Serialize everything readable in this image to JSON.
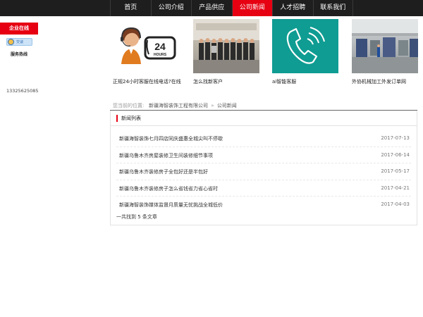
{
  "nav": {
    "items": [
      {
        "label": "首页",
        "active": false
      },
      {
        "label": "公司介绍",
        "active": false
      },
      {
        "label": "产品供应",
        "active": false
      },
      {
        "label": "公司新闻",
        "active": true
      },
      {
        "label": "人才招聘",
        "active": false
      },
      {
        "label": "联系我们",
        "active": false
      }
    ],
    "colors": {
      "bar": "#1e1e1e",
      "active": "#e60012"
    }
  },
  "service": {
    "title": "企业在线",
    "qq_label": "交谈",
    "hotline_label": "服务热线",
    "hotline_number": "13325625085"
  },
  "cards": [
    {
      "caption": "正规24小时客服在线电话?在线",
      "icon": "customer-service-24-hours-image"
    },
    {
      "caption": "怎么找新客户",
      "icon": "team-photo-image"
    },
    {
      "caption": "ai智能客服",
      "icon": "phone-icon-image"
    },
    {
      "caption": "外协机械加工外发订单网",
      "icon": "factory-photo-image"
    }
  ],
  "breadcrumb": {
    "prefix": "您当前的位置:",
    "company": "新疆海智装饰工程有限公司",
    "separator": "»",
    "current": "公司新闻"
  },
  "news": {
    "heading": "新闻列表",
    "items": [
      {
        "title": "新疆海智装饰七月四店同庆盛惠全城尖叫不停歇",
        "date": "2017-07-13"
      },
      {
        "title": "新疆乌鲁木齐房屋装修卫生间装修细节事项",
        "date": "2017-06-14"
      },
      {
        "title": "新疆乌鲁木齐装修房子全包好还是半包好",
        "date": "2017-05-17"
      },
      {
        "title": "新疆乌鲁木齐装修房子怎么省钱省力省心省时",
        "date": "2017-04-21"
      },
      {
        "title": "新疆海智装饰媒体监督月质量无忧挑战全城低价",
        "date": "2017-04-03"
      }
    ],
    "count_text": "一共找到 5 条文章"
  }
}
